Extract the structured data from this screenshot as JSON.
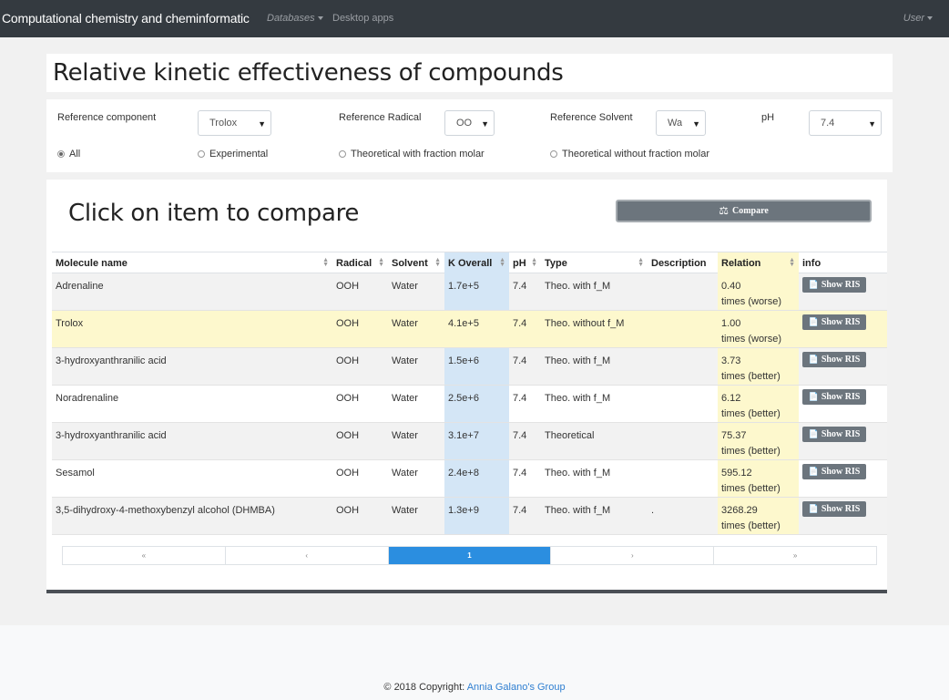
{
  "navbar": {
    "brand": "Computational chemistry and cheminformatic",
    "databases": "Databases",
    "desktop_apps": "Desktop apps",
    "user": "User"
  },
  "title_card": {
    "title": "Relative kinetic effectiveness of compounds"
  },
  "filters": {
    "ref_component_label": "Reference component",
    "ref_component_value": "Trolox",
    "ref_radical_label": "Reference Radical",
    "ref_radical_value": "OOH",
    "ref_solvent_label": "Reference Solvent",
    "ref_solvent_value": "Water",
    "ph_label": "pH",
    "ph_value": "7.4",
    "radios": [
      {
        "label": "All",
        "checked": true
      },
      {
        "label": "Experimental",
        "checked": false
      },
      {
        "label": "Theoretical with fraction molar",
        "checked": false
      },
      {
        "label": "Theoretical without fraction molar",
        "checked": false
      }
    ]
  },
  "main": {
    "subtitle": "Click on item to compare",
    "compare_label": "Compare",
    "columns": [
      "Molecule name",
      "Radical",
      "Solvent",
      "K Overall",
      "pH",
      "Type",
      "Description",
      "Relation",
      "info"
    ],
    "show_ris_label": "Show RIS",
    "rows": [
      {
        "name": "Adrenaline",
        "radical": "OOH",
        "solvent": "Water",
        "k": "1.7e+5",
        "ph": "7.4",
        "type": "Theo. with f_M",
        "desc": "",
        "rel_value": "0.40",
        "rel_text": "times (worse)"
      },
      {
        "name": "Trolox",
        "radical": "OOH",
        "solvent": "Water",
        "k": "4.1e+5",
        "ph": "7.4",
        "type": "Theo. without f_M",
        "desc": "",
        "rel_value": "1.00",
        "rel_text": "times (worse)"
      },
      {
        "name": "3-hydroxyanthranilic acid",
        "radical": "OOH",
        "solvent": "Water",
        "k": "1.5e+6",
        "ph": "7.4",
        "type": "Theo. with f_M",
        "desc": "",
        "rel_value": "3.73",
        "rel_text": "times (better)"
      },
      {
        "name": "Noradrenaline",
        "radical": "OOH",
        "solvent": "Water",
        "k": "2.5e+6",
        "ph": "7.4",
        "type": "Theo. with f_M",
        "desc": "",
        "rel_value": "6.12",
        "rel_text": "times (better)"
      },
      {
        "name": "3-hydroxyanthranilic acid",
        "radical": "OOH",
        "solvent": "Water",
        "k": "3.1e+7",
        "ph": "7.4",
        "type": "Theoretical",
        "desc": "",
        "rel_value": "75.37",
        "rel_text": "times (better)"
      },
      {
        "name": "Sesamol",
        "radical": "OOH",
        "solvent": "Water",
        "k": "2.4e+8",
        "ph": "7.4",
        "type": "Theo. with f_M",
        "desc": "",
        "rel_value": "595.12",
        "rel_text": "times (better)"
      },
      {
        "name": "3,5-dihydroxy-4-methoxybenzyl alcohol (DHMBA)",
        "radical": "OOH",
        "solvent": "Water",
        "k": "1.3e+9",
        "ph": "7.4",
        "type": "Theo. with f_M",
        "desc": ".",
        "rel_value": "3268.29",
        "rel_text": "times (better)"
      }
    ],
    "pagination": [
      "«",
      "‹",
      "1",
      "›",
      "»"
    ]
  },
  "footer": {
    "copyright": "© 2018 Copyright:",
    "link": "Annia Galano's Group"
  },
  "colors": {
    "navbar": "#343a40",
    "k_column": "#d4e6f6",
    "relation_column": "#fdf8cd",
    "active_page": "#2b8ee0",
    "button": "#6c757d"
  }
}
